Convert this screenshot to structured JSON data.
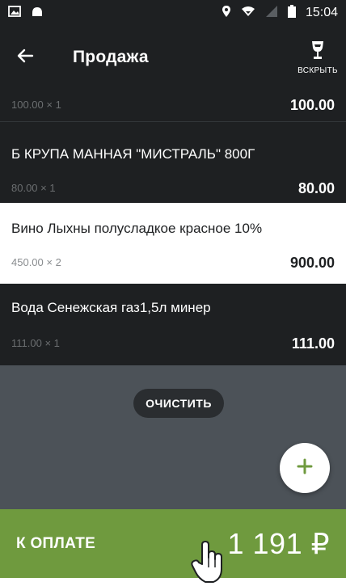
{
  "status_bar": {
    "time": "15:04"
  },
  "app_bar": {
    "title": "Продажа",
    "open_label": "ВСКРЫТЬ"
  },
  "items": [
    {
      "name": "",
      "qty": "100.00 × 1",
      "sum": "100.00",
      "theme": "dark"
    },
    {
      "name": "Б КРУПА МАННАЯ \"МИСТРАЛЬ\"  800Г",
      "qty": "80.00 × 1",
      "sum": "80.00",
      "theme": "dark"
    },
    {
      "name": "Вино Лыхны полусладкое красное 10%",
      "qty": "450.00 × 2",
      "sum": "900.00",
      "theme": "light"
    },
    {
      "name": "Вода Сенежская газ1,5л минер",
      "qty": "111.00 × 1",
      "sum": "111.00",
      "theme": "dark"
    }
  ],
  "actions": {
    "clear_label": "ОЧИСТИТЬ",
    "fab_symbol": "+"
  },
  "payment": {
    "label": "К ОПЛАТЕ",
    "total": "1 191 ₽"
  },
  "colors": {
    "dark": "#1e2022",
    "empty": "#4c5258",
    "accent": "#6f9a3e"
  },
  "icons": [
    "gallery-icon",
    "android-icon",
    "location-icon",
    "wifi-icon",
    "signal-icon",
    "battery-icon",
    "back-arrow-icon",
    "glass-icon",
    "plus-icon",
    "hand-cursor-icon"
  ]
}
